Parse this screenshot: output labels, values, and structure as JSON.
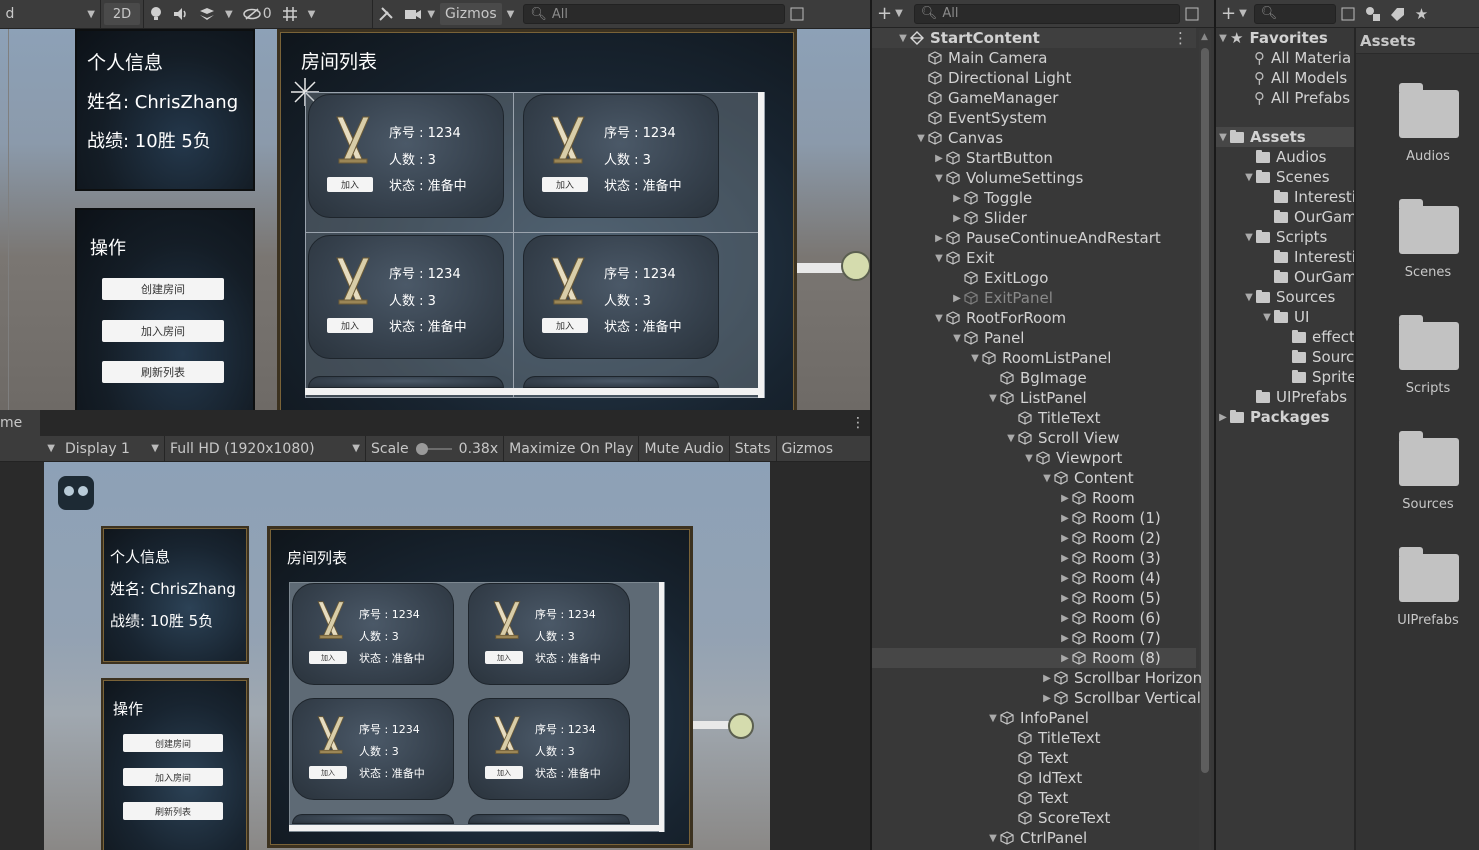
{
  "scene_toolbar": {
    "mode_2d": "2D",
    "hidden_count": "0",
    "gizmos": "Gizmos",
    "search_placeholder": "All",
    "left_edge": "d"
  },
  "scene_view": {
    "info_title": "个人信息",
    "name_line": "姓名:  ChrisZhang",
    "record_line": "战绩:  10胜   5负",
    "ops_title": "操作",
    "btn_create": "创建房间",
    "btn_join": "加入房间",
    "btn_refresh": "刷新列表",
    "list_title": "房间列表",
    "rooms": [
      {
        "id": "序号 : 1234",
        "count": "人数 : 3",
        "status": "状态 : 准备中",
        "join": "加入"
      },
      {
        "id": "序号 : 1234",
        "count": "人数 : 3",
        "status": "状态 : 准备中",
        "join": "加入"
      },
      {
        "id": "序号 : 1234",
        "count": "人数 : 3",
        "status": "状态 : 准备中",
        "join": "加入"
      },
      {
        "id": "序号 : 1234",
        "count": "人数 : 3",
        "status": "状态 : 准备中",
        "join": "加入"
      }
    ]
  },
  "game_toolbar": {
    "tab_fragment": "me",
    "display": "Display 1",
    "resolution": "Full HD (1920x1080)",
    "scale_label": "Scale",
    "scale_value": "0.38x",
    "maximize": "Maximize On Play",
    "mute": "Mute Audio",
    "stats": "Stats",
    "gizmos": "Gizmos"
  },
  "game_view": {
    "info_title": "个人信息",
    "name_line": "姓名:  ChrisZhang",
    "record_line": "战绩:  10胜   5负",
    "ops_title": "操作",
    "btn_create": "创建房间",
    "btn_join": "加入房间",
    "btn_refresh": "刷新列表",
    "list_title": "房间列表",
    "rooms": [
      {
        "id": "序号 : 1234",
        "count": "人数 : 3",
        "status": "状态 : 准备中",
        "join": "加入"
      },
      {
        "id": "序号 : 1234",
        "count": "人数 : 3",
        "status": "状态 : 准备中",
        "join": "加入"
      },
      {
        "id": "序号 : 1234",
        "count": "人数 : 3",
        "status": "状态 : 准备中",
        "join": "加入"
      },
      {
        "id": "序号 : 1234",
        "count": "人数 : 3",
        "status": "状态 : 准备中",
        "join": "加入"
      }
    ]
  },
  "hierarchy": {
    "search_placeholder": "All",
    "items": [
      {
        "label": "StartContent",
        "depth": 0,
        "arrow": "down",
        "root": true
      },
      {
        "label": "Main Camera",
        "depth": 1,
        "arrow": ""
      },
      {
        "label": "Directional Light",
        "depth": 1,
        "arrow": ""
      },
      {
        "label": "GameManager",
        "depth": 1,
        "arrow": ""
      },
      {
        "label": "EventSystem",
        "depth": 1,
        "arrow": ""
      },
      {
        "label": "Canvas",
        "depth": 1,
        "arrow": "down"
      },
      {
        "label": "StartButton",
        "depth": 2,
        "arrow": "right"
      },
      {
        "label": "VolumeSettings",
        "depth": 2,
        "arrow": "down"
      },
      {
        "label": "Toggle",
        "depth": 3,
        "arrow": "right"
      },
      {
        "label": "Slider",
        "depth": 3,
        "arrow": "right"
      },
      {
        "label": "PauseContinueAndRestart",
        "depth": 2,
        "arrow": "right"
      },
      {
        "label": "Exit",
        "depth": 2,
        "arrow": "down"
      },
      {
        "label": "ExitLogo",
        "depth": 3,
        "arrow": ""
      },
      {
        "label": "ExitPanel",
        "depth": 3,
        "arrow": "right",
        "dim": true
      },
      {
        "label": "RootForRoom",
        "depth": 2,
        "arrow": "down"
      },
      {
        "label": "Panel",
        "depth": 3,
        "arrow": "down"
      },
      {
        "label": "RoomListPanel",
        "depth": 4,
        "arrow": "down"
      },
      {
        "label": "BgImage",
        "depth": 5,
        "arrow": ""
      },
      {
        "label": "ListPanel",
        "depth": 5,
        "arrow": "down"
      },
      {
        "label": "TitleText",
        "depth": 6,
        "arrow": ""
      },
      {
        "label": "Scroll View",
        "depth": 6,
        "arrow": "down"
      },
      {
        "label": "Viewport",
        "depth": 7,
        "arrow": "down"
      },
      {
        "label": "Content",
        "depth": 8,
        "arrow": "down"
      },
      {
        "label": "Room",
        "depth": 9,
        "arrow": "right"
      },
      {
        "label": "Room (1)",
        "depth": 9,
        "arrow": "right"
      },
      {
        "label": "Room (2)",
        "depth": 9,
        "arrow": "right"
      },
      {
        "label": "Room (3)",
        "depth": 9,
        "arrow": "right"
      },
      {
        "label": "Room (4)",
        "depth": 9,
        "arrow": "right"
      },
      {
        "label": "Room (5)",
        "depth": 9,
        "arrow": "right"
      },
      {
        "label": "Room (6)",
        "depth": 9,
        "arrow": "right"
      },
      {
        "label": "Room (7)",
        "depth": 9,
        "arrow": "right"
      },
      {
        "label": "Room (8)",
        "depth": 9,
        "arrow": "right",
        "selected": true
      },
      {
        "label": "Scrollbar Horizon",
        "depth": 8,
        "arrow": "right"
      },
      {
        "label": "Scrollbar Vertical",
        "depth": 8,
        "arrow": "right"
      },
      {
        "label": "InfoPanel",
        "depth": 5,
        "arrow": "down"
      },
      {
        "label": "TitleText",
        "depth": 6,
        "arrow": ""
      },
      {
        "label": "Text",
        "depth": 6,
        "arrow": ""
      },
      {
        "label": "IdText",
        "depth": 6,
        "arrow": ""
      },
      {
        "label": "Text",
        "depth": 6,
        "arrow": ""
      },
      {
        "label": "ScoreText",
        "depth": 6,
        "arrow": ""
      },
      {
        "label": "CtrlPanel",
        "depth": 5,
        "arrow": "down"
      }
    ]
  },
  "project": {
    "favorites": "Favorites",
    "fav_items": [
      "All Materia",
      "All Models",
      "All Prefabs"
    ],
    "assets": "Assets",
    "tree": [
      {
        "label": "Audios",
        "depth": 1,
        "arrow": ""
      },
      {
        "label": "Scenes",
        "depth": 1,
        "arrow": "down"
      },
      {
        "label": "Interesti",
        "depth": 2,
        "arrow": ""
      },
      {
        "label": "OurGam",
        "depth": 2,
        "arrow": ""
      },
      {
        "label": "Scripts",
        "depth": 1,
        "arrow": "down"
      },
      {
        "label": "Interesti",
        "depth": 2,
        "arrow": ""
      },
      {
        "label": "OurGam",
        "depth": 2,
        "arrow": ""
      },
      {
        "label": "Sources",
        "depth": 1,
        "arrow": "down"
      },
      {
        "label": "UI",
        "depth": 2,
        "arrow": "down"
      },
      {
        "label": "effect",
        "depth": 3,
        "arrow": ""
      },
      {
        "label": "Sourc",
        "depth": 3,
        "arrow": ""
      },
      {
        "label": "Sprite",
        "depth": 3,
        "arrow": ""
      },
      {
        "label": "UIPrefabs",
        "depth": 1,
        "arrow": ""
      }
    ],
    "packages": "Packages",
    "grid_header": "Assets",
    "grid": [
      "Audios",
      "Scenes",
      "Scripts",
      "Sources",
      "UIPrefabs"
    ]
  },
  "colors": {
    "panel_bg": "#383838",
    "toolbar_bg": "#3c3c3c",
    "selection": "#474747",
    "slider_knob": "#d5dcae"
  }
}
